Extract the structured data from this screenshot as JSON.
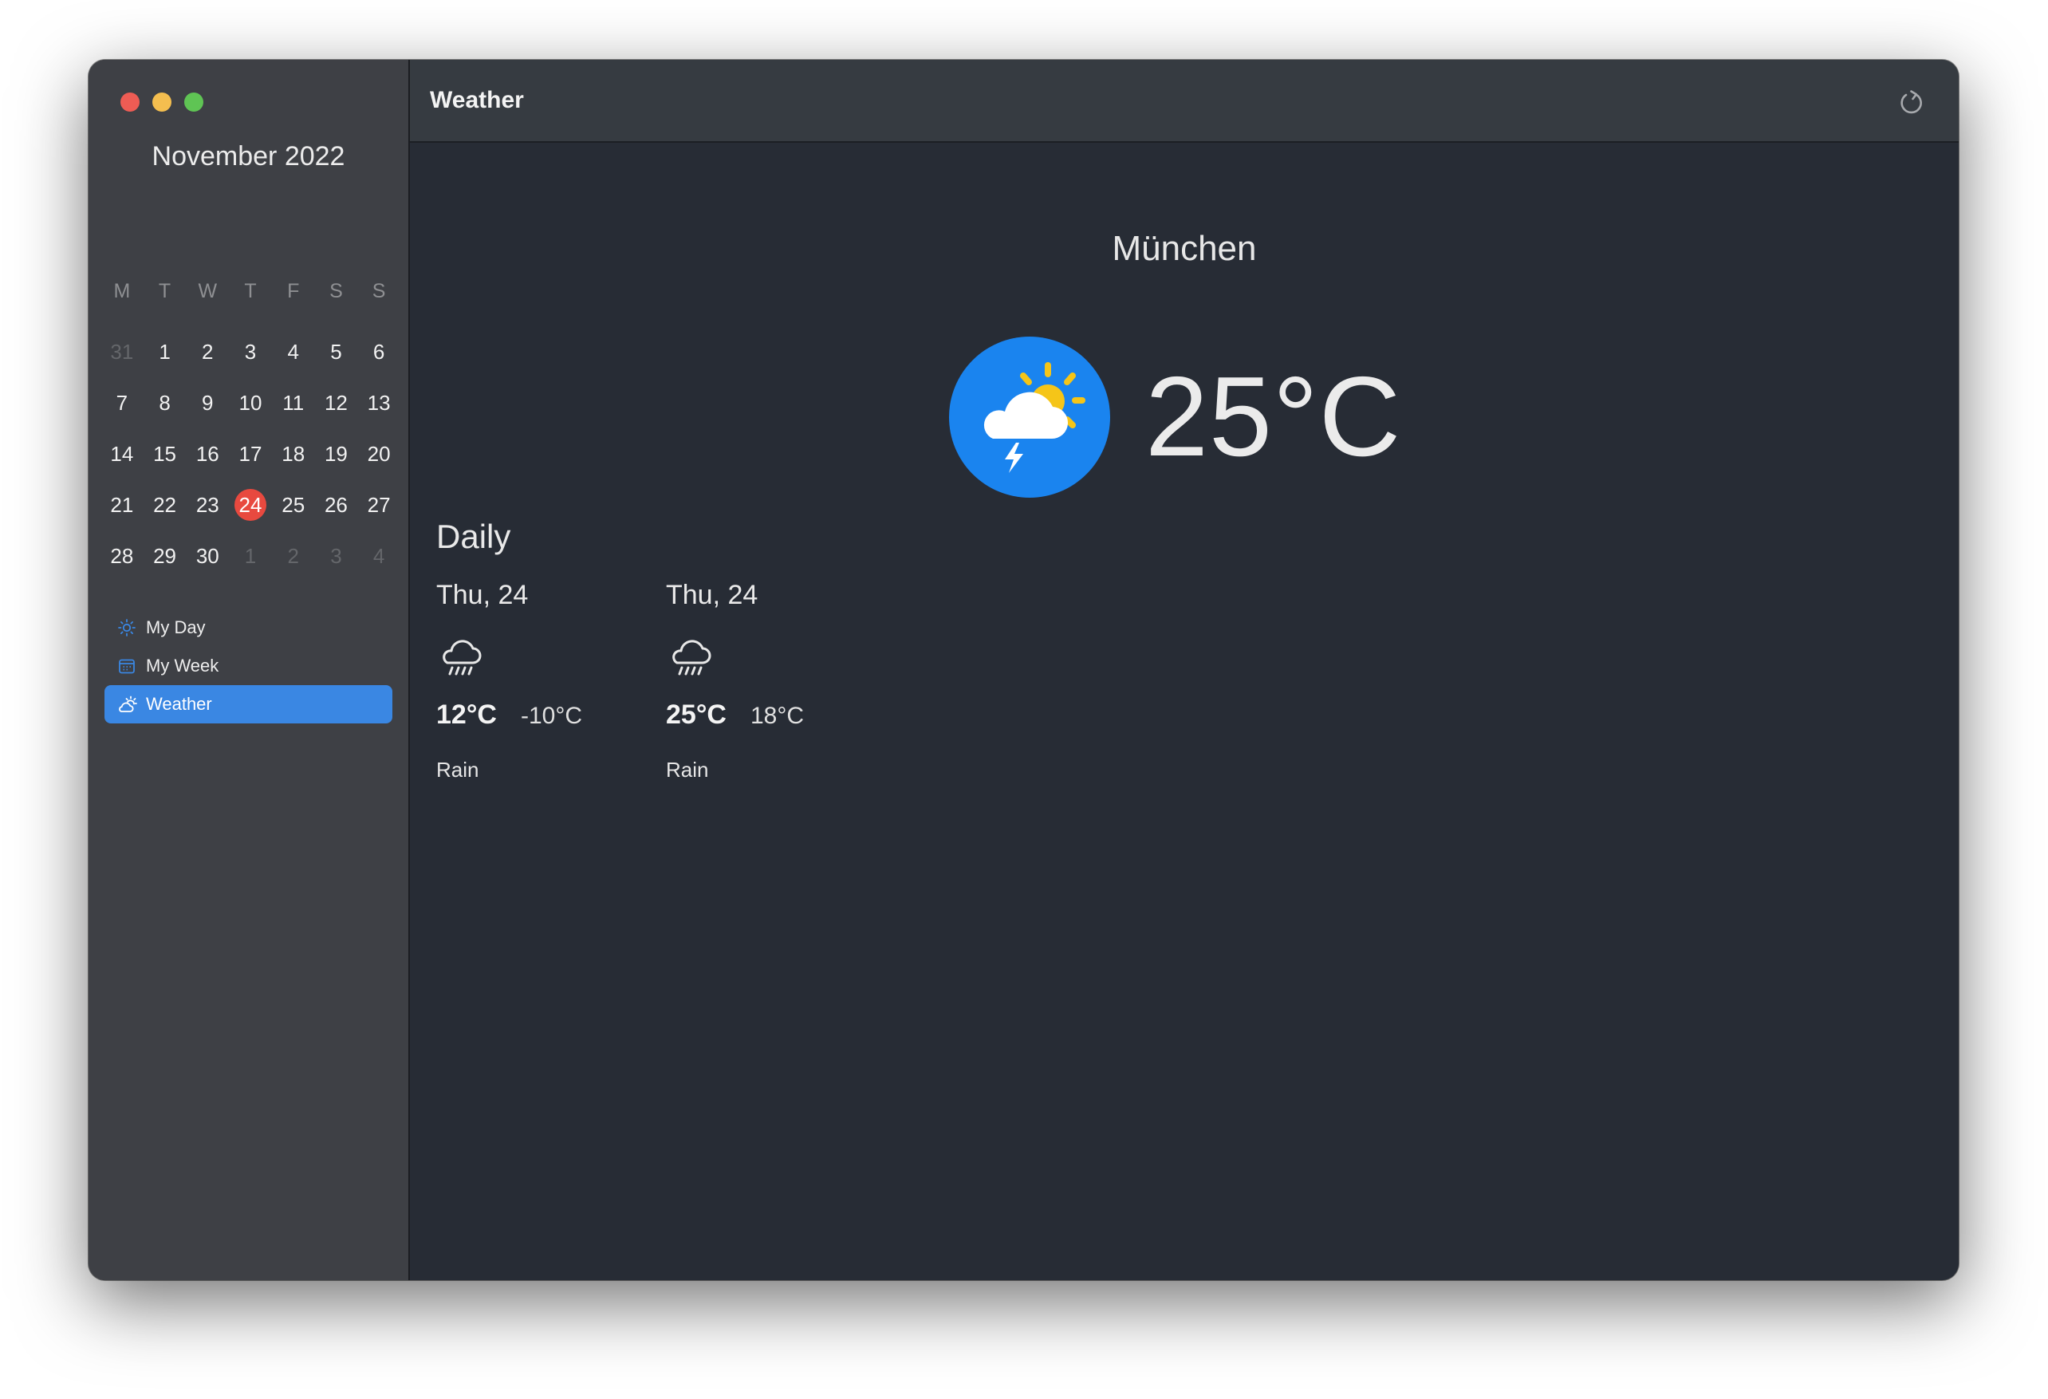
{
  "window": {
    "traffic_colors": {
      "close": "#ee5c54",
      "minimize": "#f4be4f",
      "zoom": "#5fc454"
    }
  },
  "calendar": {
    "title": "November 2022",
    "weekdays": [
      "M",
      "T",
      "W",
      "T",
      "F",
      "S",
      "S"
    ],
    "days": [
      {
        "label": "31",
        "state": "other"
      },
      {
        "label": "1",
        "state": "current"
      },
      {
        "label": "2",
        "state": "current"
      },
      {
        "label": "3",
        "state": "current"
      },
      {
        "label": "4",
        "state": "current"
      },
      {
        "label": "5",
        "state": "current"
      },
      {
        "label": "6",
        "state": "current"
      },
      {
        "label": "7",
        "state": "current"
      },
      {
        "label": "8",
        "state": "current"
      },
      {
        "label": "9",
        "state": "current"
      },
      {
        "label": "10",
        "state": "current"
      },
      {
        "label": "11",
        "state": "current"
      },
      {
        "label": "12",
        "state": "current"
      },
      {
        "label": "13",
        "state": "current"
      },
      {
        "label": "14",
        "state": "current"
      },
      {
        "label": "15",
        "state": "current"
      },
      {
        "label": "16",
        "state": "current"
      },
      {
        "label": "17",
        "state": "current"
      },
      {
        "label": "18",
        "state": "current"
      },
      {
        "label": "19",
        "state": "current"
      },
      {
        "label": "20",
        "state": "current"
      },
      {
        "label": "21",
        "state": "current"
      },
      {
        "label": "22",
        "state": "current"
      },
      {
        "label": "23",
        "state": "current"
      },
      {
        "label": "24",
        "state": "today"
      },
      {
        "label": "25",
        "state": "current"
      },
      {
        "label": "26",
        "state": "current"
      },
      {
        "label": "27",
        "state": "current"
      },
      {
        "label": "28",
        "state": "current"
      },
      {
        "label": "29",
        "state": "current"
      },
      {
        "label": "30",
        "state": "current"
      },
      {
        "label": "1",
        "state": "other"
      },
      {
        "label": "2",
        "state": "other"
      },
      {
        "label": "3",
        "state": "other"
      },
      {
        "label": "4",
        "state": "other"
      }
    ],
    "today_color": "#e8493f"
  },
  "sidebar": {
    "items": [
      {
        "label": "My Day",
        "icon": "sun-icon",
        "active": false
      },
      {
        "label": "My Week",
        "icon": "calendar-icon",
        "active": false
      },
      {
        "label": "Weather",
        "icon": "cloud-sun-icon",
        "active": true
      }
    ],
    "accent": "#3a87e3"
  },
  "header": {
    "title": "Weather",
    "refresh_icon": "refresh-icon"
  },
  "current": {
    "city": "München",
    "temperature": "25°C",
    "icon": "cloud-sun-lightning-icon",
    "icon_bg": "#1a84ef"
  },
  "daily": {
    "label": "Daily",
    "days": [
      {
        "date": "Thu, 24",
        "icon": "cloud-rain-icon",
        "high": "12°C",
        "low": "-10°C",
        "condition": "Rain"
      },
      {
        "date": "Thu, 24",
        "icon": "cloud-rain-icon",
        "high": "25°C",
        "low": "18°C",
        "condition": "Rain"
      }
    ]
  }
}
